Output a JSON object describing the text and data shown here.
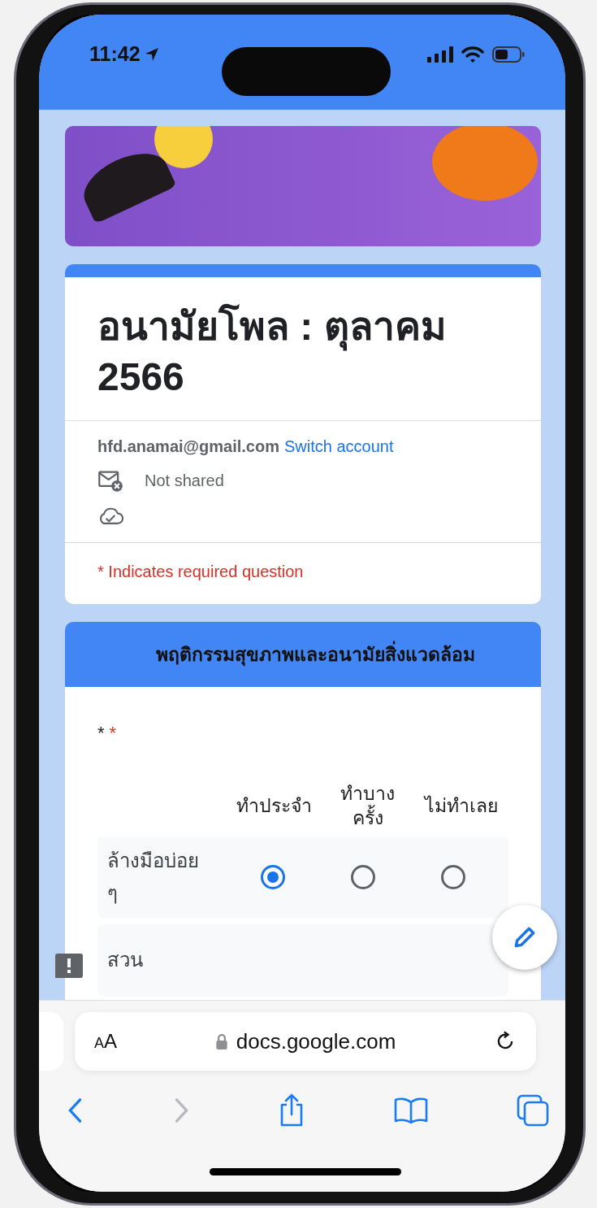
{
  "status_bar": {
    "time": "11:42"
  },
  "form": {
    "title": "อนามัยโพล : ตุลาคม 2566",
    "account_email": "hfd.anamai@gmail.com",
    "switch_account": "Switch account",
    "sharing": "Not shared",
    "required_note": "* Indicates required question"
  },
  "section": {
    "title": "พฤติกรรมสุขภาพและอนามัยสิ่งแวดล้อม"
  },
  "question": {
    "title": "*",
    "required_mark": "*",
    "columns": [
      "ทำประจำ",
      "ทำบางครั้ง",
      "ไม่ทำเลย"
    ],
    "rows": [
      {
        "label": "ล้างมือบ่อย ๆ",
        "options": [
          {
            "selected": true
          },
          {
            "selected": false
          },
          {
            "selected": false
          }
        ]
      },
      {
        "label": "สวน"
      }
    ]
  },
  "browser": {
    "text_size": "AA",
    "url": "docs.google.com",
    "back": {
      "disabled": false
    },
    "forward": {
      "disabled": true
    }
  }
}
